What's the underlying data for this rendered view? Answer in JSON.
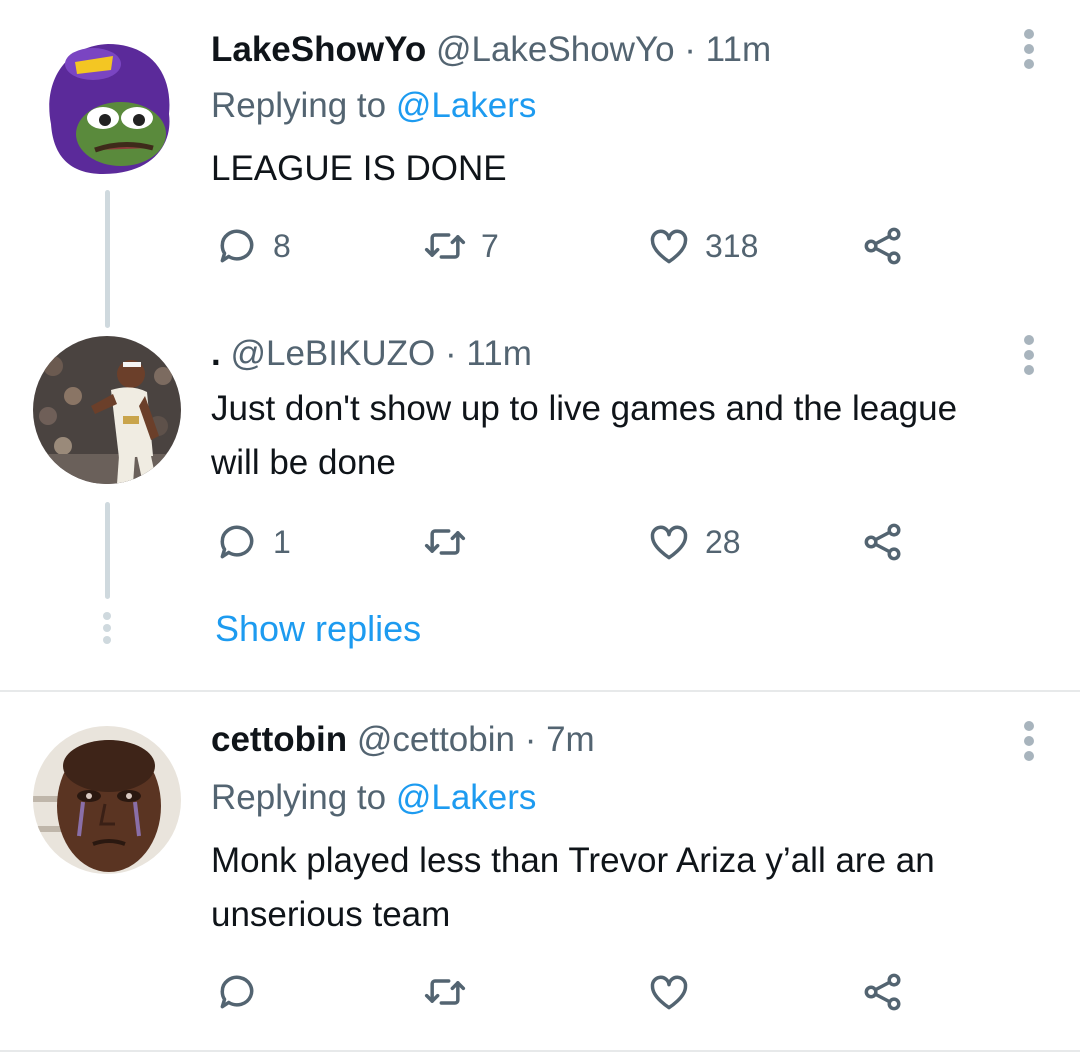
{
  "tweets": [
    {
      "name": "LakeShowYo",
      "handle": "@LakeShowYo",
      "separator": "·",
      "time": "11m",
      "replying_label": "Replying to",
      "replying_to": "@Lakers",
      "text": "LEAGUE IS DONE",
      "reply_count": "8",
      "retweet_count": "7",
      "like_count": "318",
      "avatar_icon": "lakers-hood-frog-avatar"
    },
    {
      "name": ".",
      "handle": "@LeBIKUZO",
      "separator": "·",
      "time": "11m",
      "text": "Just don't show up to live games and the league will be done",
      "reply_count": "1",
      "retweet_count": "",
      "like_count": "28",
      "avatar_icon": "basketball-player-avatar"
    },
    {
      "name": "cettobin",
      "handle": "@cettobin",
      "separator": "·",
      "time": "7m",
      "replying_label": "Replying to",
      "replying_to": "@Lakers",
      "text": "Monk played less than Trevor Ariza y’all are an unserious team",
      "reply_count": "",
      "retweet_count": "",
      "like_count": "",
      "avatar_icon": "crying-face-avatar"
    }
  ],
  "show_replies_label": "Show replies",
  "icons": {
    "reply": "reply-icon",
    "retweet": "retweet-icon",
    "like": "heart-icon",
    "share": "share-icon",
    "more": "more-options-icon"
  },
  "colors": {
    "link": "#1d9bf0",
    "secondary_text": "#536471",
    "thread_line": "#cfd9de"
  }
}
